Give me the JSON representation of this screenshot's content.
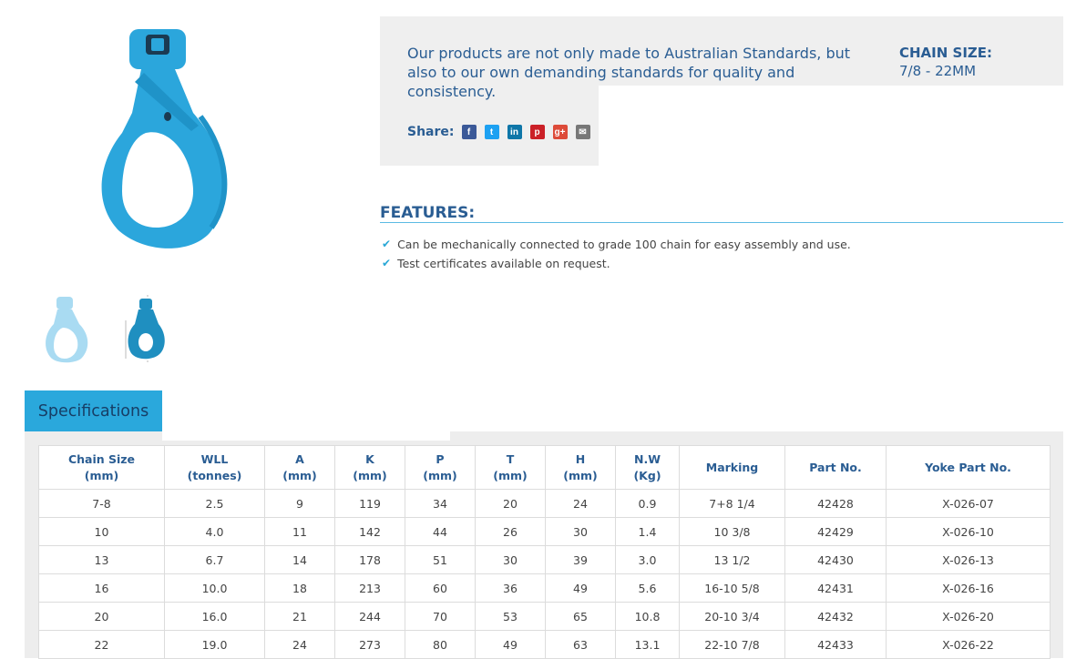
{
  "intro": {
    "text": "Our products are not only made to Australian Standards, but also to our own demanding standards for quality and consistency.",
    "chain_size_label": "CHAIN SIZE:",
    "chain_size_value": "7/8 - 22MM"
  },
  "share": {
    "label": "Share:",
    "buttons": [
      {
        "name": "facebook",
        "glyph": "f",
        "color": "#3b5998"
      },
      {
        "name": "twitter",
        "glyph": "t",
        "color": "#1da1f2"
      },
      {
        "name": "linkedin",
        "glyph": "in",
        "color": "#0e76a8"
      },
      {
        "name": "pinterest",
        "glyph": "p",
        "color": "#cb2027"
      },
      {
        "name": "google-plus",
        "glyph": "g+",
        "color": "#dd4b39"
      },
      {
        "name": "email",
        "glyph": "✉",
        "color": "#777777"
      }
    ]
  },
  "features": {
    "title": "FEATURES:",
    "items": [
      "Can be mechanically connected to grade 100 chain for easy assembly and use.",
      "Test certificates available on request."
    ]
  },
  "specs": {
    "tab_label": "Specifications",
    "headers": [
      "Chain Size\n(mm)",
      "WLL\n(tonnes)",
      "A\n(mm)",
      "K\n(mm)",
      "P\n(mm)",
      "T\n(mm)",
      "H\n(mm)",
      "N.W\n(Kg)",
      "Marking",
      "Part No.",
      "Yoke Part No."
    ],
    "rows": [
      [
        "7-8",
        "2.5",
        "9",
        "119",
        "34",
        "20",
        "24",
        "0.9",
        "7+8 1/4",
        "42428",
        "X-026-07"
      ],
      [
        "10",
        "4.0",
        "11",
        "142",
        "44",
        "26",
        "30",
        "1.4",
        "10 3/8",
        "42429",
        "X-026-10"
      ],
      [
        "13",
        "6.7",
        "14",
        "178",
        "51",
        "30",
        "39",
        "3.0",
        "13 1/2",
        "42430",
        "X-026-13"
      ],
      [
        "16",
        "10.0",
        "18",
        "213",
        "60",
        "36",
        "49",
        "5.6",
        "16-10 5/8",
        "42431",
        "X-026-16"
      ],
      [
        "20",
        "16.0",
        "21",
        "244",
        "70",
        "53",
        "65",
        "10.8",
        "20-10 3/4",
        "42432",
        "X-026-20"
      ],
      [
        "22",
        "19.0",
        "24",
        "273",
        "80",
        "49",
        "63",
        "13.1",
        "22-10 7/8",
        "42433",
        "X-026-22"
      ]
    ]
  },
  "colors": {
    "hook_blue": "#2ba6dc",
    "brand_blue": "#2a5d93",
    "tab_blue": "#2aa8dc"
  }
}
